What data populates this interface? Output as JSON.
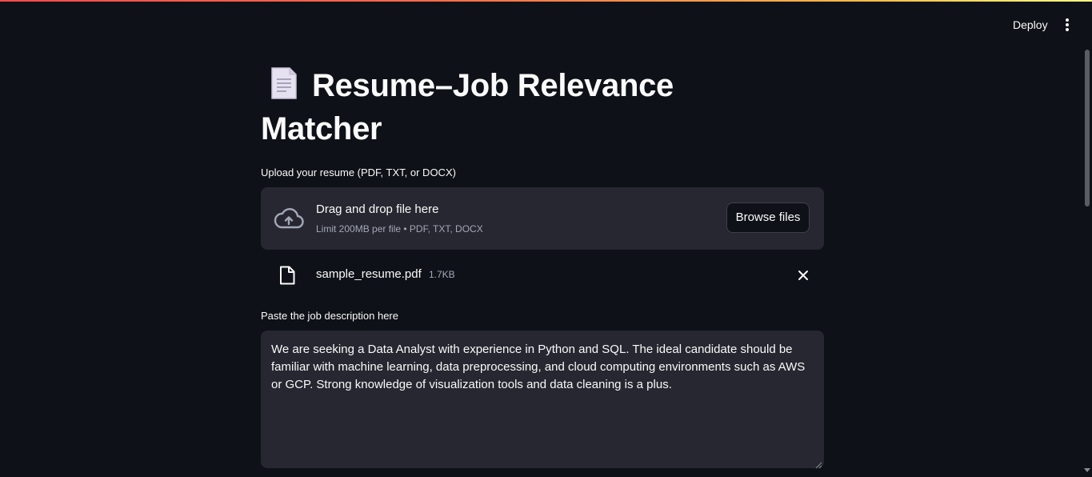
{
  "header": {
    "deploy_label": "Deploy",
    "menu_icon": "kebab-menu-icon"
  },
  "page": {
    "title_emoji_icon": "page-facing-up-icon",
    "title": "Resume–Job Relevance Matcher"
  },
  "uploader": {
    "label": "Upload your resume (PDF, TXT, or DOCX)",
    "dropzone_icon": "cloud-upload-icon",
    "dropzone_title": "Drag and drop file here",
    "dropzone_subtitle": "Limit 200MB per file • PDF, TXT, DOCX",
    "browse_label": "Browse files",
    "uploaded_file": {
      "icon": "file-icon",
      "name": "sample_resume.pdf",
      "size": "1.7KB",
      "remove_icon": "close-icon"
    }
  },
  "job_description": {
    "label": "Paste the job description here",
    "value": "We are seeking a Data Analyst with experience in Python and SQL. The ideal candidate should be familiar with machine learning, data preprocessing, and cloud computing environments such as AWS or GCP. Strong knowledge of visualization tools and data cleaning is a plus."
  },
  "colors": {
    "background": "#0e1117",
    "widget_background": "#262730",
    "text": "#fafafa",
    "muted_text": "#a3a8b8",
    "accent_stripe_start": "#ff4b4b",
    "accent_stripe_end": "#fffd80"
  }
}
